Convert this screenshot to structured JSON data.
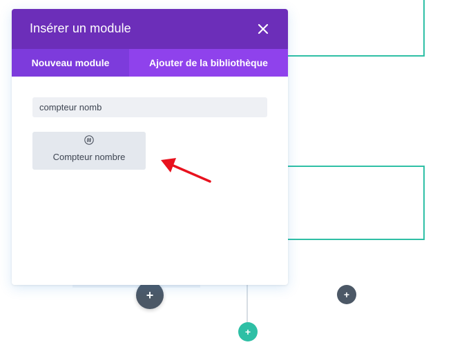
{
  "modal": {
    "title": "Insérer un module",
    "tabs": [
      {
        "label": "Nouveau module",
        "active": true
      },
      {
        "label": "Ajouter de la bibliothèque",
        "active": false
      }
    ],
    "search": {
      "value": "compteur nomb",
      "placeholder": ""
    },
    "results": [
      {
        "label": "Compteur nombre",
        "icon": "hash-icon"
      }
    ]
  },
  "builder": {
    "add_module_buttons": [
      {
        "label": "+",
        "style": "dark"
      },
      {
        "label": "+",
        "style": "dark"
      },
      {
        "label": "+",
        "style": "teal"
      }
    ]
  },
  "colors": {
    "header": "#6c2eb9",
    "tabs": "#8f42ec",
    "active_tab": "#7d3bdc",
    "teal": "#2ebfa5",
    "dark_button": "#4c5866",
    "annotation_arrow": "#e8121e"
  }
}
